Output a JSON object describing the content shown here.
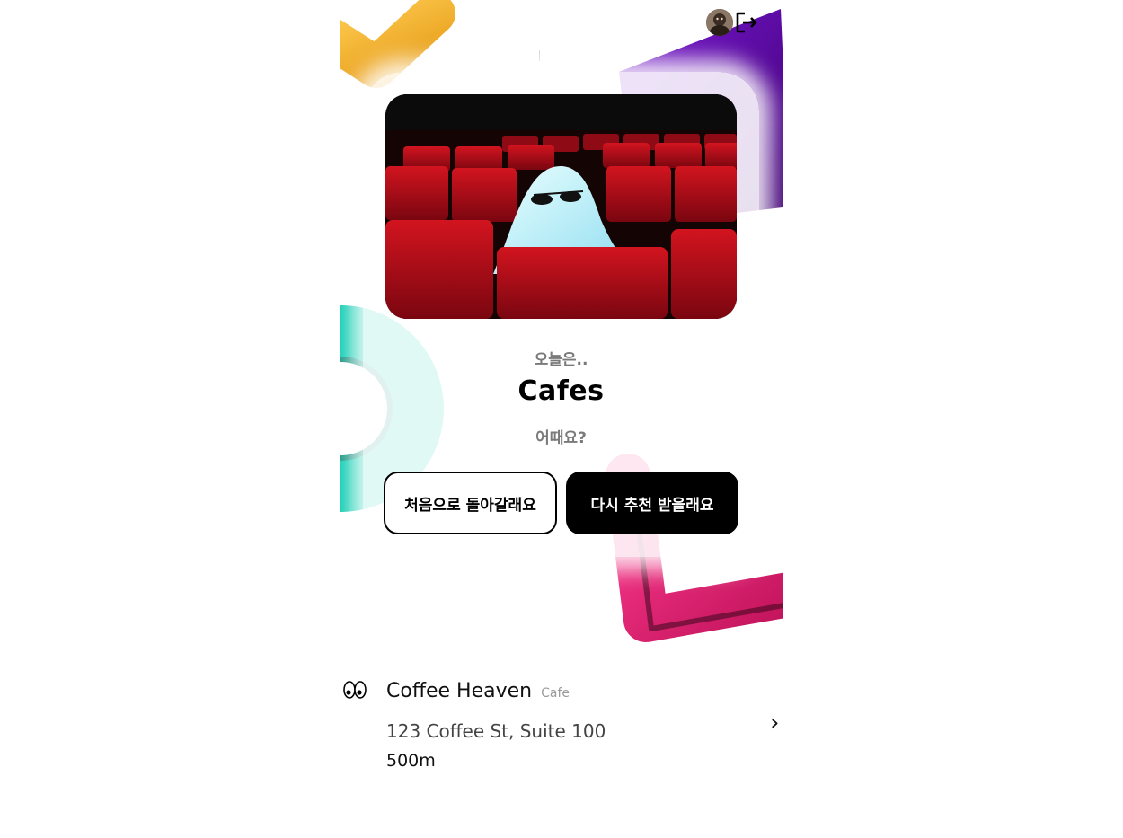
{
  "header": {
    "avatar_icon": "profile-avatar",
    "logout_icon": "logout-icon"
  },
  "card": {
    "intro_top": "오늘은..",
    "category": "Cafes",
    "intro_bottom": "어때요?",
    "image": "ghost-in-cinema-seats-photo",
    "buttons": {
      "restart_label": "처음으로 돌아갈래요",
      "again_label": "다시 추천 받을래요"
    }
  },
  "place": {
    "icon": "eyes-icon",
    "name": "Coffee Heaven",
    "type": "Cafe",
    "address": "123 Coffee St, Suite 100",
    "distance": "500m",
    "detail_icon": "chevron-right-icon"
  },
  "colors": {
    "yellow": "#f7b731",
    "purple": "#5b00a8",
    "teal": "#00c4aa",
    "pink": "#f21e78",
    "primary_button": "#000000"
  }
}
